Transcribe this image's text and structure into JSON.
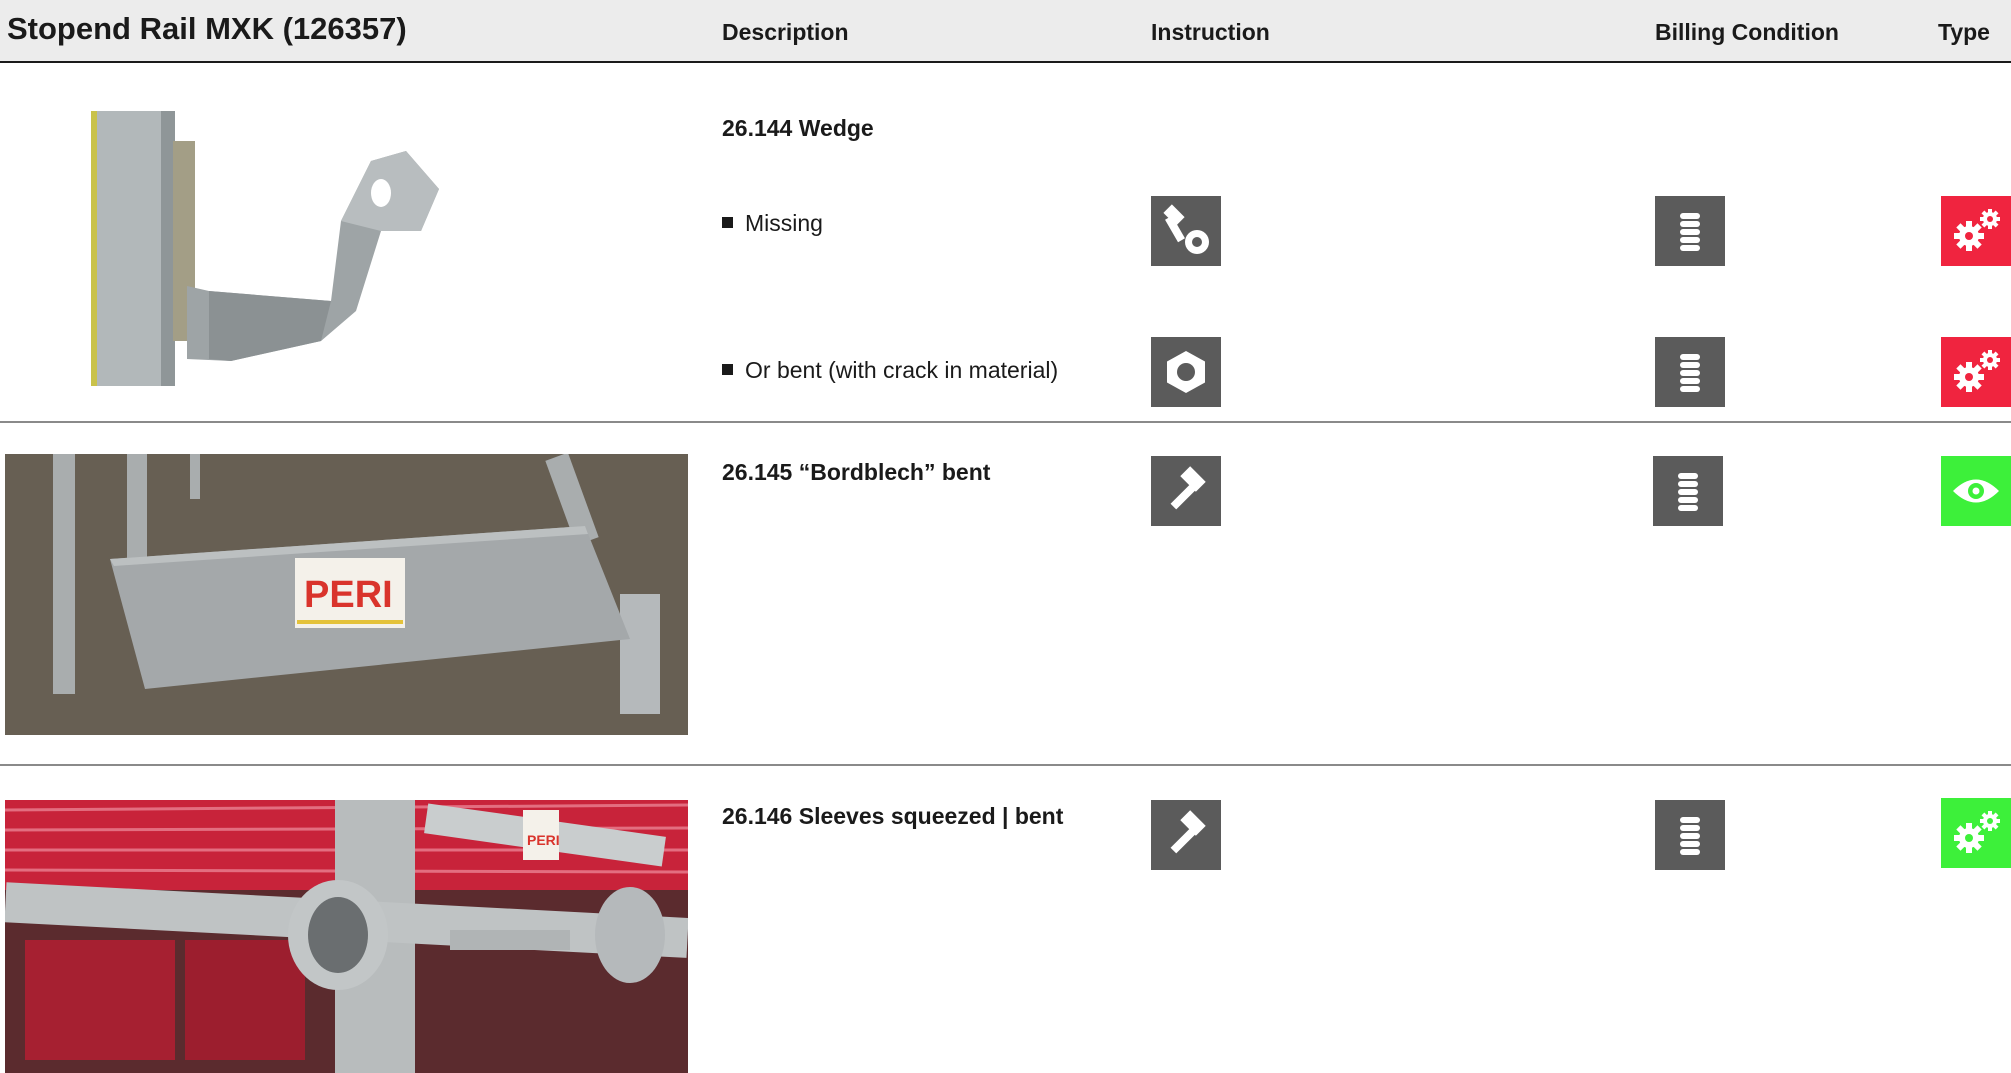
{
  "header": {
    "title": "Stopend Rail MXK (126357)",
    "col_description": "Description",
    "col_instruction": "Instruction",
    "col_billing": "Billing Condition",
    "col_type": "Type"
  },
  "rows": [
    {
      "title": "26.144 Wedge",
      "items": [
        {
          "bullet": "Missing",
          "instruction_icon": "bolt-nut-icon",
          "billing_icon": "coin-stack-icon",
          "type_icon": "gears-icon",
          "type_color": "#f0243f"
        },
        {
          "bullet": "Or bent (with crack in material)",
          "instruction_icon": "nut-icon",
          "billing_icon": "coin-stack-icon",
          "type_icon": "gears-icon",
          "type_color": "#f0243f"
        }
      ]
    },
    {
      "title": "26.145 “Bordblech” bent",
      "instruction_icon": "hammer-icon",
      "billing_icon": "coin-stack-icon",
      "type_icon": "eye-icon",
      "type_color": "#3df03a",
      "photo_label": "PERI"
    },
    {
      "title": "26.146 Sleeves squeezed | bent",
      "instruction_icon": "hammer-icon",
      "billing_icon": "coin-stack-icon",
      "type_icon": "gears-icon",
      "type_color": "#3df03a",
      "photo_label": "PERI"
    }
  ],
  "colors": {
    "icon_gray": "#5b5b5b",
    "type_red": "#f0243f",
    "type_green": "#3df03a",
    "header_bg": "#ececec"
  }
}
